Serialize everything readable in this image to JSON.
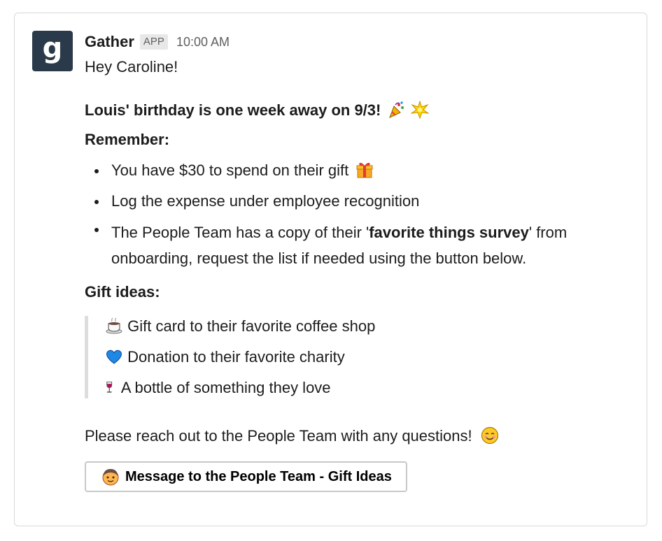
{
  "message": {
    "avatar_letter": "g",
    "sender": "Gather",
    "badge": "APP",
    "time": "10:00 AM",
    "greeting": "Hey Caroline!",
    "headline": "Louis' birthday is one week away on 9/3!",
    "headline_emojis": [
      "party-popper-icon",
      "sparkle-burst-icon"
    ],
    "remember_title": "Remember:",
    "remember_items": [
      {
        "text": "You have $30 to spend on their gift",
        "emoji": "gift-icon"
      },
      {
        "text": "Log the expense under employee recognition"
      },
      {
        "pre": "The People Team has a copy of their '",
        "bold": "favorite things survey",
        "post": "' from onboarding, request the list if needed using the button below."
      }
    ],
    "gift_title": "Gift ideas:",
    "gift_ideas": [
      {
        "text": "Gift card to their favorite coffee shop",
        "emoji": "coffee-icon"
      },
      {
        "text": "Donation to their favorite charity",
        "emoji": "blue-heart-icon"
      },
      {
        "text": "A bottle of something they love",
        "emoji": "wine-glass-icon"
      }
    ],
    "footer": "Please reach out to the People Team with any questions!",
    "footer_emoji": "smiling-face-icon",
    "button_label": "Message to the People Team - Gift Ideas",
    "button_emoji": "boy-face-icon"
  }
}
